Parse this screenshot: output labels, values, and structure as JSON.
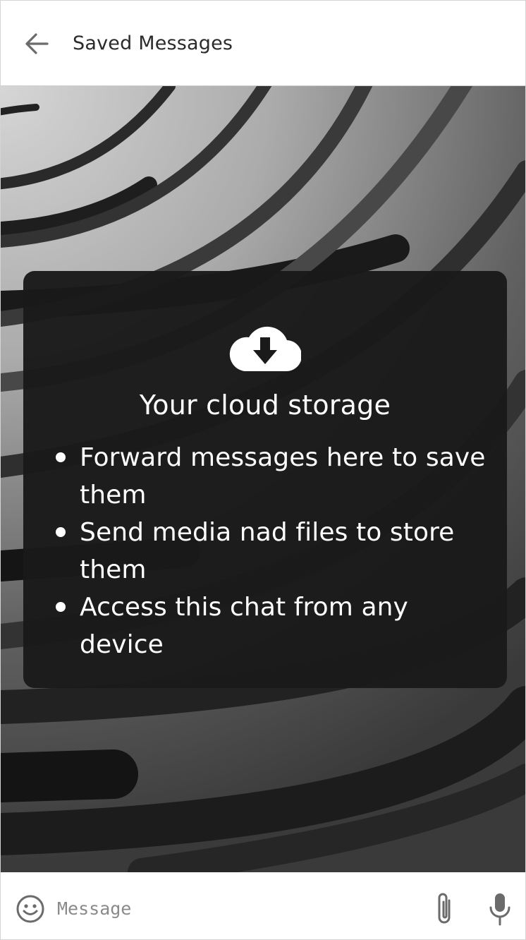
{
  "header": {
    "title": "Saved Messages",
    "back_icon": "arrow-left-icon"
  },
  "info_card": {
    "icon": "cloud-download-icon",
    "title": "Your cloud storage",
    "items": [
      "Forward messages here to save them",
      "Send media nad files to store them",
      "Access this chat from any device"
    ]
  },
  "composer": {
    "emoji_icon": "smiley-icon",
    "placeholder": "Message",
    "attach_icon": "paperclip-icon",
    "mic_icon": "microphone-icon"
  },
  "colors": {
    "card_background": "#1a1a1a",
    "header_background": "#ffffff",
    "icon_gray": "#6b6b6b"
  }
}
